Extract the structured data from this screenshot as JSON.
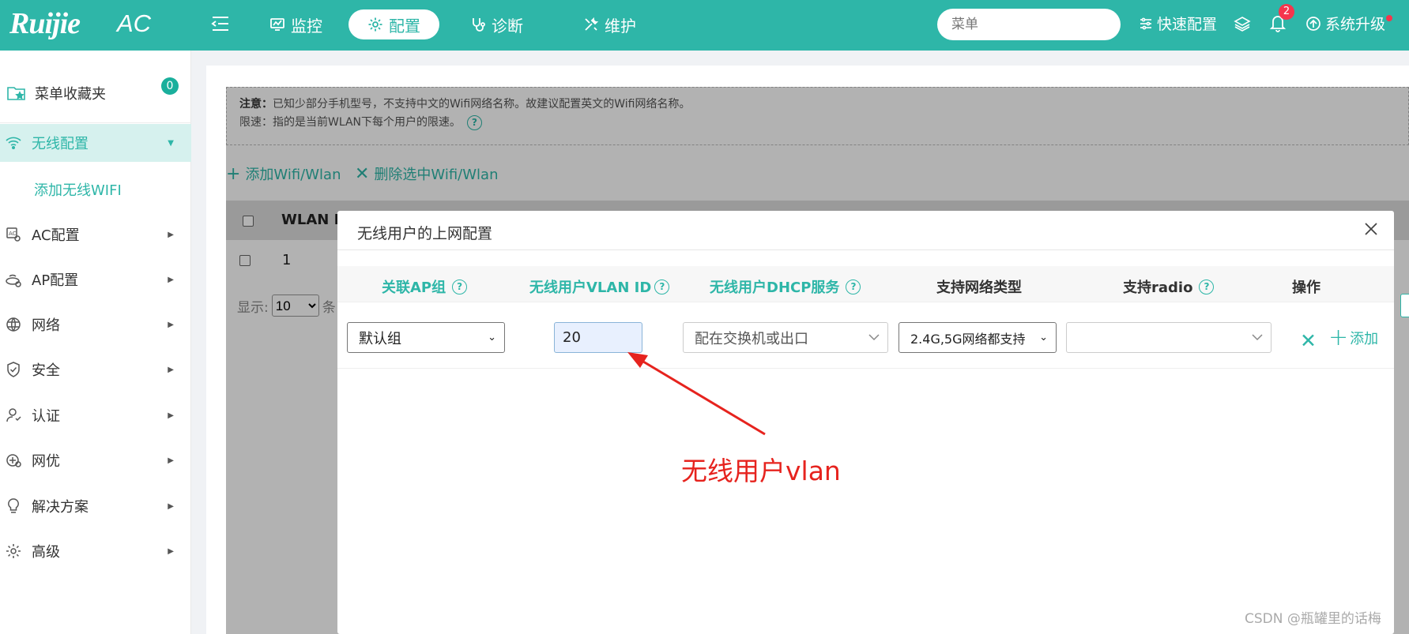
{
  "header": {
    "logo": "Ruijie",
    "logo_suffix": "AC",
    "nav": [
      {
        "label": "监控",
        "icon": "monitor-icon"
      },
      {
        "label": "配置",
        "icon": "gear-icon",
        "active": true
      },
      {
        "label": "诊断",
        "icon": "stethoscope-icon"
      },
      {
        "label": "维护",
        "icon": "tools-icon"
      }
    ],
    "search_placeholder": "菜单",
    "quick_config": "快速配置",
    "notification_count": "2",
    "upgrade": "系统升级",
    "accent_color": "#2eb6a8"
  },
  "sidebar": {
    "favorites": {
      "label": "菜单收藏夹",
      "count": "0"
    },
    "items": [
      {
        "label": "无线配置",
        "icon": "wifi-icon",
        "active": true
      },
      {
        "label": "AC配置",
        "icon": "ac-icon"
      },
      {
        "label": "AP配置",
        "icon": "ap-icon"
      },
      {
        "label": "网络",
        "icon": "network-icon"
      },
      {
        "label": "安全",
        "icon": "shield-icon"
      },
      {
        "label": "认证",
        "icon": "user-icon"
      },
      {
        "label": "网优",
        "icon": "optimize-icon"
      },
      {
        "label": "解决方案",
        "icon": "bulb-icon"
      },
      {
        "label": "高级",
        "icon": "gear-icon"
      }
    ],
    "submenu": "添加无线WIFI"
  },
  "page": {
    "notice_label": "注意：",
    "notice_text": "已知少部分手机型号，不支持中文的Wifi网络名称。故建议配置英文的Wifi网络名称。",
    "limit_text": "限速：指的是当前WLAN下每个用户的限速。",
    "add_link": "添加Wifi/Wlan",
    "delete_link": "删除选中Wifi/Wlan",
    "table_header": "WLAN I",
    "row_value": "1",
    "pager_label": "显示:",
    "pager_size": "10",
    "pager_suffix": "条"
  },
  "modal": {
    "title": "无线用户的上网配置",
    "columns": [
      "关联AP组",
      "无线用户VLAN ID",
      "无线用户DHCP服务",
      "支持网络类型",
      "支持radio",
      "操作"
    ],
    "row": {
      "ap_group": "默认组",
      "vlan_id": "20",
      "dhcp": "配在交换机或出口",
      "net_type": "2.4G,5G网络都支持",
      "radio": ""
    },
    "op_add": "添加"
  },
  "annotation": {
    "text": "无线用户vlan",
    "color": "#e6231e"
  },
  "watermark": "CSDN @瓶罐里的话梅"
}
